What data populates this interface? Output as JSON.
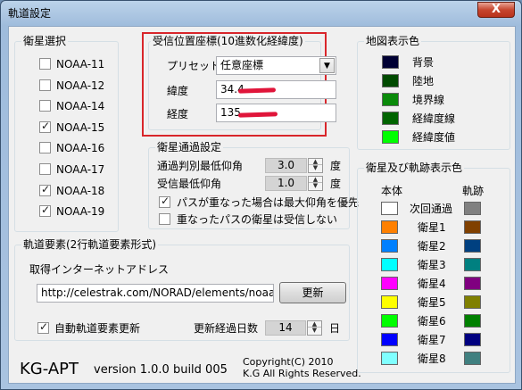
{
  "window": {
    "title": "軌道設定",
    "close_label": "X"
  },
  "satellite_select": {
    "title": "衛星選択",
    "items": [
      {
        "label": "NOAA-11",
        "checked": false
      },
      {
        "label": "NOAA-12",
        "checked": false
      },
      {
        "label": "NOAA-14",
        "checked": false
      },
      {
        "label": "NOAA-15",
        "checked": true
      },
      {
        "label": "NOAA-16",
        "checked": false
      },
      {
        "label": "NOAA-17",
        "checked": false
      },
      {
        "label": "NOAA-18",
        "checked": true
      },
      {
        "label": "NOAA-19",
        "checked": true
      }
    ]
  },
  "receive_position": {
    "title": "受信位置座標(10進数化経緯度)",
    "preset_label": "プリセット",
    "preset_value": "任意座標",
    "lat_label": "緯度",
    "lat_value": "34.4",
    "lon_label": "経度",
    "lon_value": "135."
  },
  "pass_settings": {
    "title": "衛星通過設定",
    "min_elev_judge_label": "通過判別最低仰角",
    "min_elev_judge_value": "3.0",
    "min_elev_receive_label": "受信最低仰角",
    "min_elev_receive_value": "1.0",
    "unit": "度",
    "overlap_priority_label": "パスが重なった場合は最大仰角を優先",
    "overlap_priority_checked": true,
    "overlap_skip_label": "重なったパスの衛星は受信しない",
    "overlap_skip_checked": false
  },
  "map_colors": {
    "title": "地図表示色",
    "items": [
      {
        "label": "背景",
        "color": "#000033"
      },
      {
        "label": "陸地",
        "color": "#004a00"
      },
      {
        "label": "境界線",
        "color": "#0a8a0a"
      },
      {
        "label": "経緯度線",
        "color": "#006400"
      },
      {
        "label": "経緯度値",
        "color": "#00ff00"
      }
    ]
  },
  "sat_colors": {
    "title": "衛星及び軌跡表示色",
    "body_header": "本体",
    "track_header": "軌跡",
    "items": [
      {
        "label": "次回通過",
        "body": "#ffffff",
        "track": "#808080"
      },
      {
        "label": "衛星1",
        "body": "#ff8000",
        "track": "#804000"
      },
      {
        "label": "衛星2",
        "body": "#0080ff",
        "track": "#004080"
      },
      {
        "label": "衛星3",
        "body": "#00ffff",
        "track": "#008080"
      },
      {
        "label": "衛星4",
        "body": "#ff00ff",
        "track": "#800080"
      },
      {
        "label": "衛星5",
        "body": "#ffff00",
        "track": "#808000"
      },
      {
        "label": "衛星6",
        "body": "#00ff00",
        "track": "#008000"
      },
      {
        "label": "衛星7",
        "body": "#0000ff",
        "track": "#000080"
      },
      {
        "label": "衛星8",
        "body": "#80ffff",
        "track": "#408080"
      }
    ]
  },
  "orbital_elements": {
    "title": "軌道要素(2行軌道要素形式)",
    "internet_label": "取得インターネットアドレス",
    "url_value": "http://celestrak.com/NORAD/elements/noaa.txt",
    "update_button": "更新",
    "auto_update_label": "自動軌道要素更新",
    "auto_update_checked": true,
    "interval_label": "更新経過日数",
    "interval_value": "14",
    "interval_unit": "日"
  },
  "footer": {
    "app_name": "KG-APT",
    "version": "version 1.0.0 build 005",
    "copyright": "Copyright(C) 2010",
    "rights": "K.G All Rights Reserved."
  }
}
